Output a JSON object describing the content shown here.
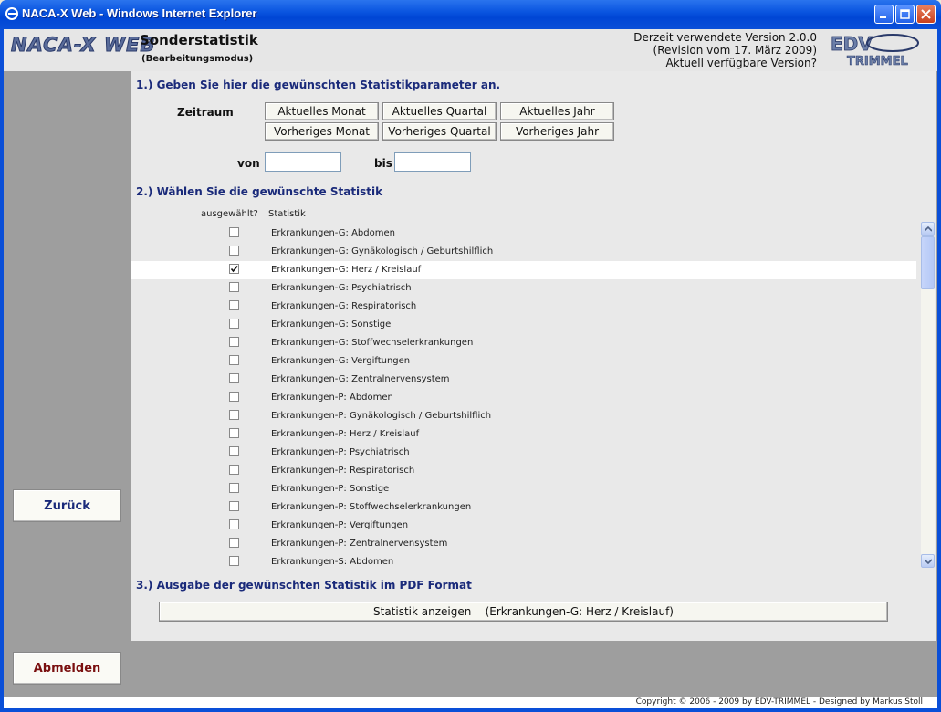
{
  "window": {
    "title": "NACA-X Web - Windows Internet Explorer",
    "icon": "ie-icon"
  },
  "header": {
    "logo_text": "NACA-X WEB",
    "title": "Sonderstatistik",
    "subtitle": "(Bearbeitungsmodus)",
    "version_line1": "Derzeit verwendete Version 2.0.0",
    "version_line2": "(Revision vom 17. März 2009)",
    "version_line3": "Aktuell verfügbare Version?",
    "brand_logo": "EDV TRIMMEL"
  },
  "sidebar": {
    "back_label": "Zurück",
    "logout_label": "Abmelden"
  },
  "section1": {
    "heading": "1.) Geben Sie hier die gewünschten Statistikparameter an.",
    "period_label": "Zeitraum",
    "buttons": [
      "Aktuelles Monat",
      "Aktuelles Quartal",
      "Aktuelles Jahr",
      "Vorheriges Monat",
      "Vorheriges Quartal",
      "Vorheriges Jahr"
    ],
    "from_label": "von",
    "to_label": "bis",
    "from_value": "",
    "to_value": ""
  },
  "section2": {
    "heading": "2.) Wählen Sie die gewünschte Statistik",
    "col_selected": "ausgewählt?",
    "col_statistic": "Statistik",
    "items": [
      {
        "label": "Erkrankungen-G: Abdomen",
        "checked": false
      },
      {
        "label": "Erkrankungen-G: Gynäkologisch / Geburtshilflich",
        "checked": false
      },
      {
        "label": "Erkrankungen-G: Herz / Kreislauf",
        "checked": true
      },
      {
        "label": "Erkrankungen-G: Psychiatrisch",
        "checked": false
      },
      {
        "label": "Erkrankungen-G: Respiratorisch",
        "checked": false
      },
      {
        "label": "Erkrankungen-G: Sonstige",
        "checked": false
      },
      {
        "label": "Erkrankungen-G: Stoffwechselerkrankungen",
        "checked": false
      },
      {
        "label": "Erkrankungen-G: Vergiftungen",
        "checked": false
      },
      {
        "label": "Erkrankungen-G: Zentralnervensystem",
        "checked": false
      },
      {
        "label": "Erkrankungen-P: Abdomen",
        "checked": false
      },
      {
        "label": "Erkrankungen-P: Gynäkologisch / Geburtshilflich",
        "checked": false
      },
      {
        "label": "Erkrankungen-P: Herz / Kreislauf",
        "checked": false
      },
      {
        "label": "Erkrankungen-P: Psychiatrisch",
        "checked": false
      },
      {
        "label": "Erkrankungen-P: Respiratorisch",
        "checked": false
      },
      {
        "label": "Erkrankungen-P: Sonstige",
        "checked": false
      },
      {
        "label": "Erkrankungen-P: Stoffwechselerkrankungen",
        "checked": false
      },
      {
        "label": "Erkrankungen-P: Vergiftungen",
        "checked": false
      },
      {
        "label": "Erkrankungen-P: Zentralnervensystem",
        "checked": false
      },
      {
        "label": "Erkrankungen-S: Abdomen",
        "checked": false
      }
    ]
  },
  "section3": {
    "heading": "3.) Ausgabe der gewünschten Statistik im PDF Format",
    "show_button": "Statistik anzeigen    (Erkrankungen-G: Herz / Kreislauf)"
  },
  "footer": {
    "copyright": "Copyright © 2006 - 2009 by EDV-TRIMMEL - Designed by Markus Stoll"
  }
}
